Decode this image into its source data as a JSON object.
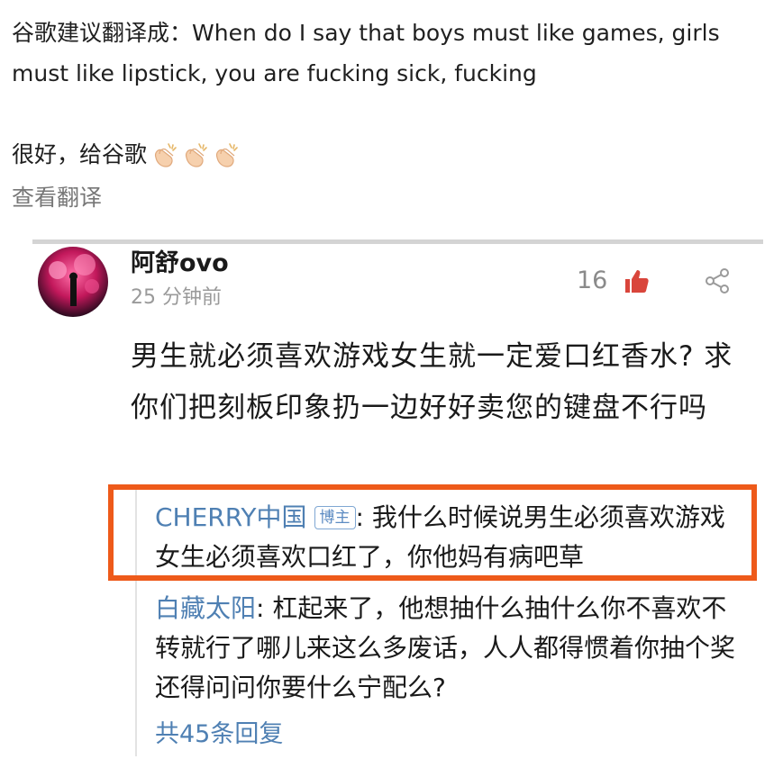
{
  "post": {
    "translation_prefix": "谷歌建议翻译成：",
    "translation_text": "When do I say that boys must like games, girls must like lipstick, you are fucking sick, fucking",
    "good_text": "很好，给谷歌",
    "emoji": [
      "clap-icon",
      "clap-icon",
      "clap-icon"
    ],
    "view_translation": "查看翻译"
  },
  "comment": {
    "username": "阿舒ovo",
    "time": "25 分钟前",
    "like_count": "16",
    "text": "男生就必须喜欢游戏女生就一定爱口红香水? 求你们把刻板印象扔一边好好卖您的键盘不行吗",
    "replies": [
      {
        "user": "CHERRY中国",
        "badge": "博主",
        "text": ": 我什么时候说男生必须喜欢游戏女生必须喜欢口红了，你他妈有病吧草"
      },
      {
        "user": "白藏太阳",
        "text": ": 杠起来了，他想抽什么抽什么你不喜欢不转就行了哪儿来这么多废话，人人都得惯着你抽个奖还得问问你要什么宁配么?"
      }
    ],
    "more_replies": "共45条回复"
  },
  "colors": {
    "highlight": "#ee5a1a",
    "link": "#4f80b3",
    "like": "#d9453b"
  }
}
